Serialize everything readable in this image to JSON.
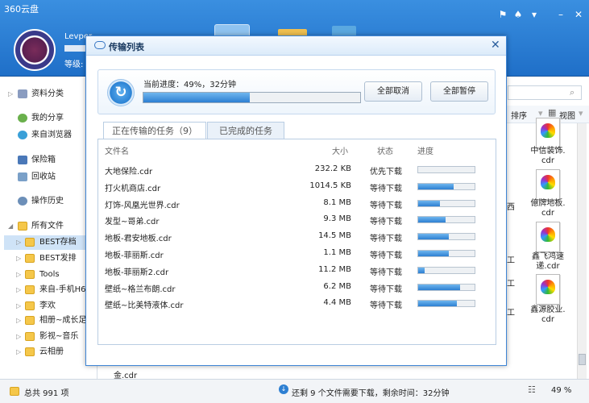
{
  "app": {
    "title": "360云盘",
    "username": "Levper",
    "level_label": "等级:"
  },
  "window_controls": [
    "shirt-icon",
    "skin-icon",
    "menu-icon",
    "minimize-icon",
    "close-icon"
  ],
  "sidebar": {
    "items": [
      {
        "label": "资料分类",
        "icon": "book-icon"
      },
      {
        "label": "我的分享",
        "icon": "share-icon"
      },
      {
        "label": "来自浏览器",
        "icon": "browser-icon"
      },
      {
        "label": "保险箱",
        "icon": "safe-icon"
      },
      {
        "label": "回收站",
        "icon": "recycle-icon"
      },
      {
        "label": "操作历史",
        "icon": "history-icon"
      },
      {
        "label": "所有文件",
        "icon": "folder-icon"
      },
      {
        "label": "BEST存档",
        "icon": "folder-icon"
      },
      {
        "label": "BEST发排",
        "icon": "folder-icon"
      },
      {
        "label": "Tools",
        "icon": "folder-icon"
      },
      {
        "label": "来自-手机H6",
        "icon": "folder-icon"
      },
      {
        "label": "李欢",
        "icon": "folder-icon"
      },
      {
        "label": "相册~成长足",
        "icon": "folder-icon"
      },
      {
        "label": "影视~音乐",
        "icon": "folder-icon"
      },
      {
        "label": "云相册",
        "icon": "folder-icon"
      }
    ]
  },
  "right_panel": {
    "sort_label": "排序",
    "view_label": "视图",
    "files": [
      {
        "label": "中信装饰."
      },
      {
        "label": "cdr"
      },
      {
        "label": "億牌地板."
      },
      {
        "label": "cdr"
      },
      {
        "label": "鑫飞鸿速"
      },
      {
        "label": "递.cdr"
      },
      {
        "label": "鑫源胶业."
      },
      {
        "label": "cdr"
      }
    ],
    "partials": [
      "西",
      "工",
      "工",
      "工"
    ]
  },
  "background_file": {
    "label": "金.cdr"
  },
  "status": {
    "total": "总共 991 项",
    "message": "还剩 9 个文件需要下载，剩余时间：32分钟",
    "zoom": "49 %"
  },
  "dialog": {
    "title": "传输列表",
    "progress_label": "当前进度：49%，32分钟",
    "progress": 0.49,
    "cancel_all": "全部取消",
    "pause_all": "全部暂停",
    "tabs": {
      "active": "正在传输的任务（9）",
      "done": "已完成的任务"
    },
    "columns": {
      "name": "文件名",
      "size": "大小",
      "state": "状态",
      "progress": "进度"
    },
    "rows": [
      {
        "name": "大地保险.cdr",
        "size": "232.2 KB",
        "state": "优先下载",
        "progress": 0
      },
      {
        "name": "打火机商店.cdr",
        "size": "1014.5 KB",
        "state": "等待下载",
        "progress": 0.63
      },
      {
        "name": "灯饰-风凰光世界.cdr",
        "size": "8.1 MB",
        "state": "等待下载",
        "progress": 0.38
      },
      {
        "name": "发型~哥弟.cdr",
        "size": "9.3 MB",
        "state": "等待下载",
        "progress": 0.49
      },
      {
        "name": "地板-君安地板.cdr",
        "size": "14.5 MB",
        "state": "等待下载",
        "progress": 0.54
      },
      {
        "name": "地板-菲丽斯.cdr",
        "size": "1.1 MB",
        "state": "等待下载",
        "progress": 0.54
      },
      {
        "name": "地板-菲丽斯2.cdr",
        "size": "11.2 MB",
        "state": "等待下载",
        "progress": 0.11
      },
      {
        "name": "壁纸~格兰布朗.cdr",
        "size": "6.2 MB",
        "state": "等待下载",
        "progress": 0.74
      },
      {
        "name": "壁纸~比美特液体.cdr",
        "size": "4.4 MB",
        "state": "等待下载",
        "progress": 0.69
      }
    ]
  }
}
